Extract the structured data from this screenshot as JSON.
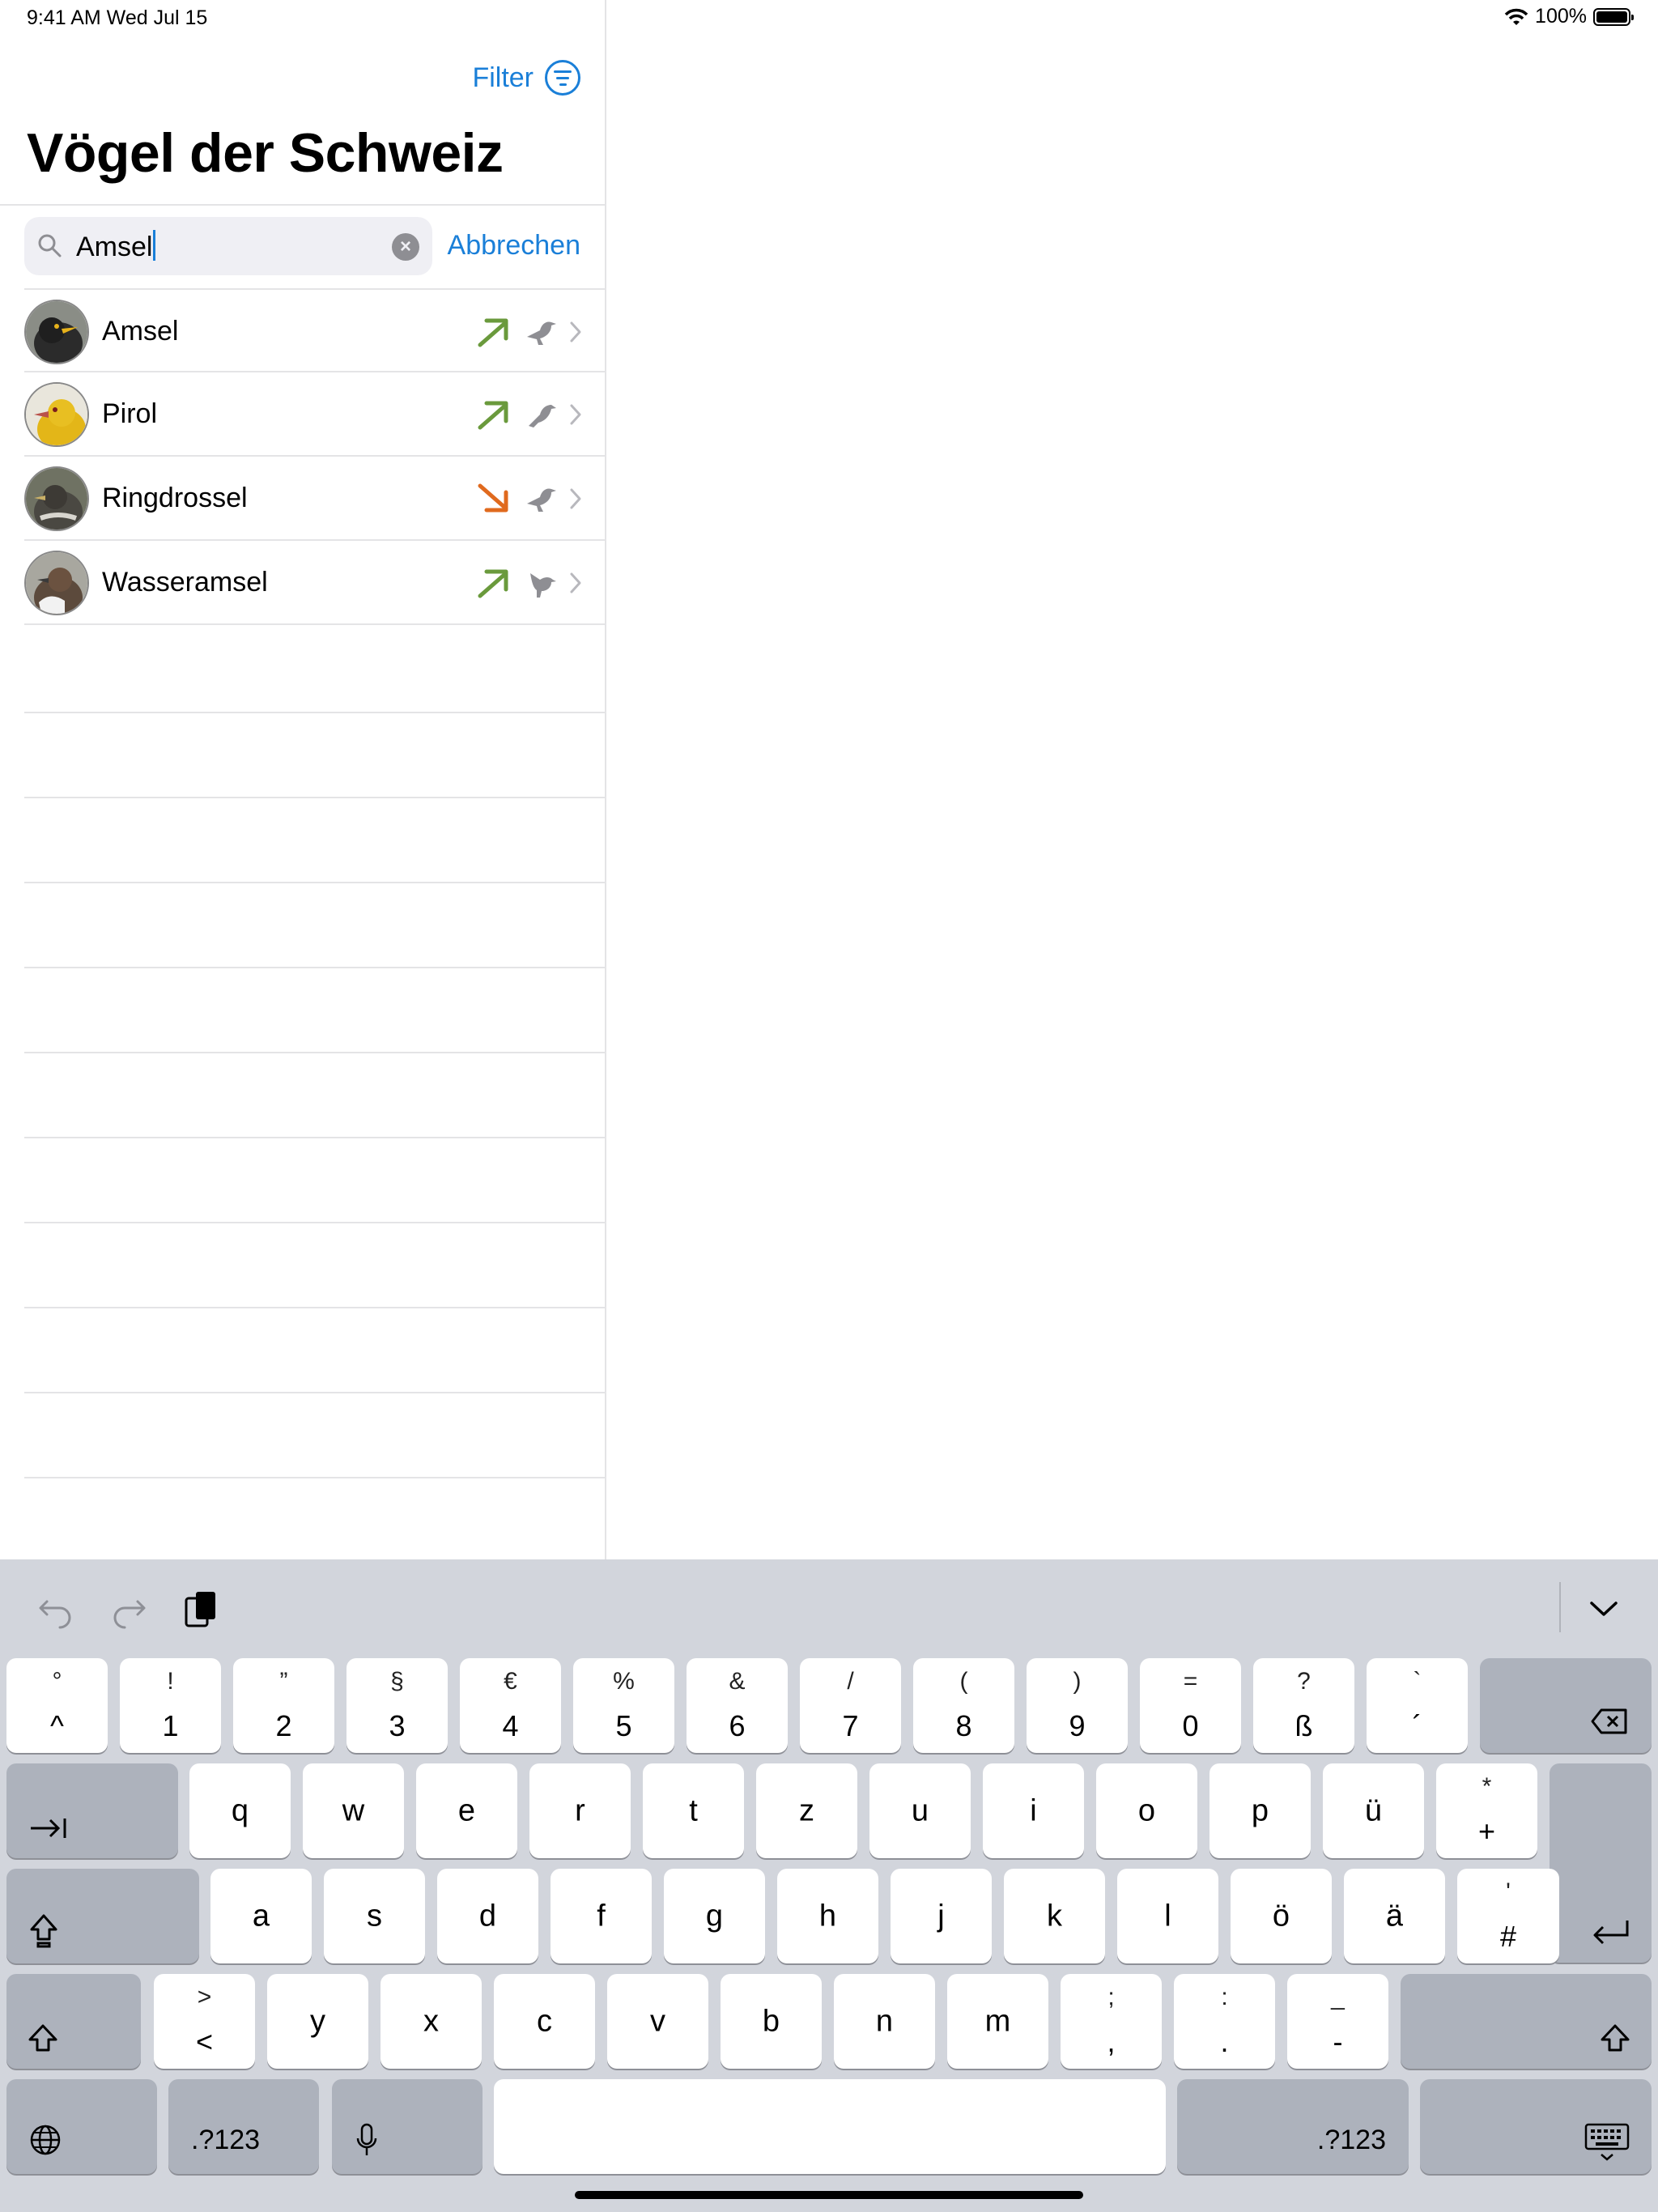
{
  "status": {
    "time": "9:41 AM   Wed Jul 15",
    "battery": "100%"
  },
  "sidebar": {
    "filter_label": "Filter",
    "title": "Vögel der Schweiz",
    "search": {
      "value": "Amsel",
      "cancel_label": "Abbrechen"
    },
    "results": [
      {
        "name": "Amsel",
        "trend": "up",
        "trend_color": "#6a9a3c"
      },
      {
        "name": "Pirol",
        "trend": "up",
        "trend_color": "#6a9a3c"
      },
      {
        "name": "Ringdrossel",
        "trend": "down",
        "trend_color": "#e06a1e"
      },
      {
        "name": "Wasseramsel",
        "trend": "up",
        "trend_color": "#6a9a3c"
      }
    ]
  },
  "keyboard": {
    "row1": [
      {
        "top": "°",
        "bot": "^"
      },
      {
        "top": "!",
        "bot": "1"
      },
      {
        "top": "”",
        "bot": "2"
      },
      {
        "top": "§",
        "bot": "3"
      },
      {
        "top": "€",
        "bot": "4"
      },
      {
        "top": "%",
        "bot": "5"
      },
      {
        "top": "&",
        "bot": "6"
      },
      {
        "top": "/",
        "bot": "7"
      },
      {
        "top": "(",
        "bot": "8"
      },
      {
        "top": ")",
        "bot": "9"
      },
      {
        "top": "=",
        "bot": "0"
      },
      {
        "top": "?",
        "bot": "ß"
      },
      {
        "top": "`",
        "bot": "´"
      }
    ],
    "row2": [
      "q",
      "w",
      "e",
      "r",
      "t",
      "z",
      "u",
      "i",
      "o",
      "p",
      "ü"
    ],
    "row2_last": {
      "top": "*",
      "bot": "+"
    },
    "row3": [
      "a",
      "s",
      "d",
      "f",
      "g",
      "h",
      "j",
      "k",
      "l",
      "ö",
      "ä"
    ],
    "row3_last": {
      "top": "'",
      "bot": "#"
    },
    "row4_first": {
      "top": ">",
      "bot": "<"
    },
    "row4": [
      "y",
      "x",
      "c",
      "v",
      "b",
      "n",
      "m"
    ],
    "row4_punct": [
      {
        "top": ";",
        "bot": ","
      },
      {
        "top": ":",
        "bot": "."
      },
      {
        "top": "_",
        "bot": "-"
      }
    ],
    "numbers_label": ".?123"
  },
  "colors": {
    "accent": "#1a7fd8",
    "keyboard_bg": "#d2d5dc"
  }
}
